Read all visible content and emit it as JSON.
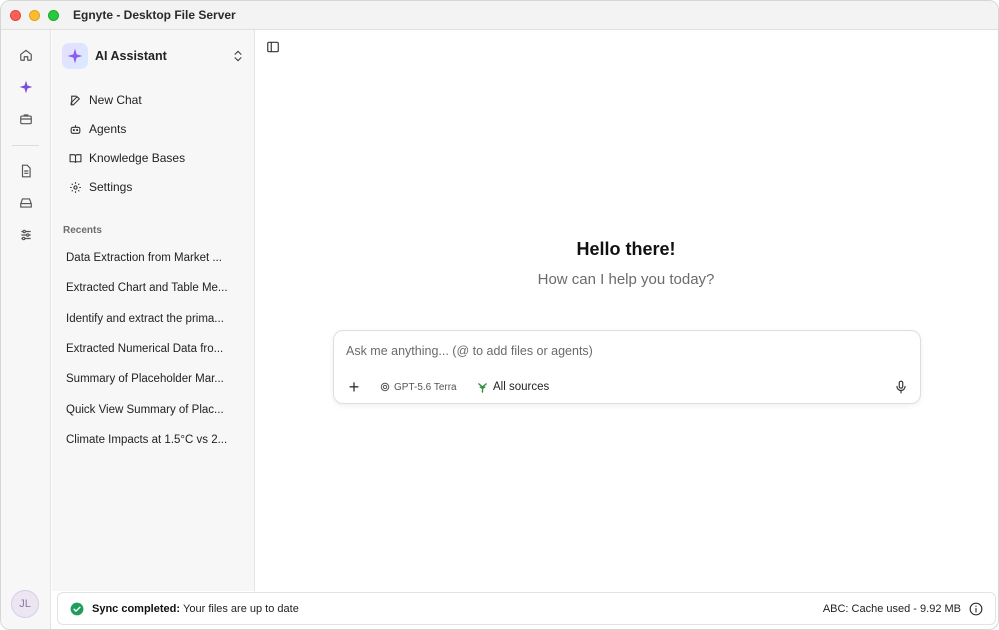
{
  "window": {
    "title": "Egnyte - Desktop File Server"
  },
  "user": {
    "initials": "JL"
  },
  "panel": {
    "assistant_name": "AI Assistant",
    "nav": [
      {
        "label": "New Chat",
        "icon": "edit-icon"
      },
      {
        "label": "Agents",
        "icon": "robot-icon"
      },
      {
        "label": "Knowledge Bases",
        "icon": "book-icon"
      },
      {
        "label": "Settings",
        "icon": "gear-icon"
      }
    ],
    "recents_label": "Recents",
    "recents": [
      "Data Extraction from Market ...",
      "Extracted Chart and Table Me...",
      "Identify and extract the prima...",
      "Extracted Numerical Data fro...",
      "Summary of Placeholder Mar...",
      "Quick View Summary of Plac...",
      "Climate Impacts at 1.5°C vs 2..."
    ]
  },
  "main": {
    "greeting": "Hello there!",
    "subtitle": "How can I help you today?",
    "composer": {
      "placeholder": "Ask me anything... (@ to add files or agents)",
      "plus_label": "+",
      "model": "GPT-5.6 Terra",
      "sources": "All sources"
    }
  },
  "status": {
    "strong": "Sync completed:",
    "text": "Your files are up to date",
    "cache": "ABC: Cache used - 9.92 MB"
  },
  "colors": {
    "accent": "#7c4ddb",
    "success": "#1e9e5a",
    "sources": "#2f8f3a"
  }
}
